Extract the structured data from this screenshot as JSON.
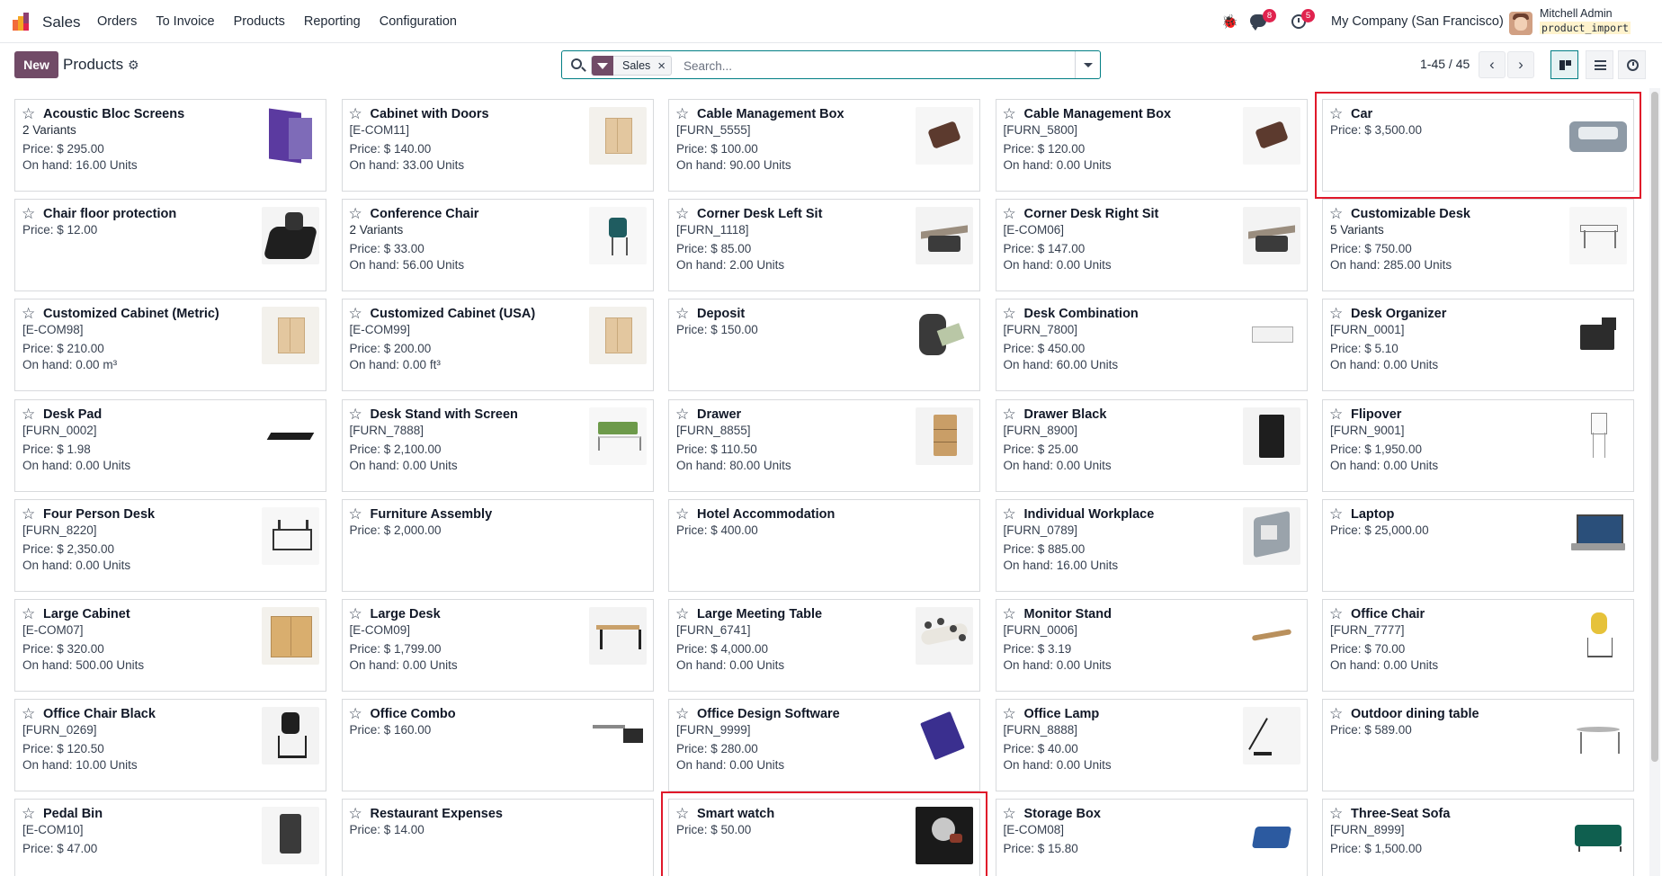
{
  "navbar": {
    "app_name": "Sales",
    "menu": [
      "Orders",
      "To Invoice",
      "Products",
      "Reporting",
      "Configuration"
    ],
    "messages_badge": "8",
    "activities_badge": "5",
    "company": "My Company (San Francisco)",
    "user_name": "Mitchell Admin",
    "database": "product_import"
  },
  "control_panel": {
    "new_label": "New",
    "title": "Products",
    "search": {
      "facet_label": "Sales",
      "placeholder": "Search..."
    },
    "pager": {
      "value": "1-45 / 45"
    }
  },
  "products": [
    {
      "name": "Acoustic Bloc Screens",
      "sub": "2 Variants",
      "price": "Price: $ 295.00",
      "onhand": "On hand: 16.00 Units",
      "thumb": "screens"
    },
    {
      "name": "Cabinet with Doors",
      "sub": "[E-COM11]",
      "price": "Price: $ 140.00",
      "onhand": "On hand: 33.00 Units",
      "thumb": "wood"
    },
    {
      "name": "Cable Management Box",
      "sub": "[FURN_5555]",
      "price": "Price: $ 100.00",
      "onhand": "On hand: 90.00 Units",
      "thumb": "dark-box"
    },
    {
      "name": "Cable Management Box",
      "sub": "[FURN_5800]",
      "price": "Price: $ 120.00",
      "onhand": "On hand: 0.00 Units",
      "thumb": "dark-box"
    },
    {
      "name": "Car",
      "sub": "",
      "price": "Price: $ 3,500.00",
      "onhand": "",
      "thumb": "car"
    },
    {
      "name": "Chair floor protection",
      "sub": "",
      "price": "Price: $ 12.00",
      "onhand": "",
      "thumb": "chairmat"
    },
    {
      "name": "Conference Chair",
      "sub": "2 Variants",
      "price": "Price: $ 33.00",
      "onhand": "On hand: 56.00 Units",
      "thumb": "teal-chair"
    },
    {
      "name": "Corner Desk Left Sit",
      "sub": "[FURN_1118]",
      "price": "Price: $ 85.00",
      "onhand": "On hand: 2.00 Units",
      "thumb": "desk-scene"
    },
    {
      "name": "Corner Desk Right Sit",
      "sub": "[E-COM06]",
      "price": "Price: $ 147.00",
      "onhand": "On hand: 0.00 Units",
      "thumb": "desk-scene"
    },
    {
      "name": "Customizable Desk",
      "sub": "5 Variants",
      "price": "Price: $ 750.00",
      "onhand": "On hand: 285.00 Units",
      "thumb": "white-desk"
    },
    {
      "name": "Customized Cabinet (Metric)",
      "sub": "[E-COM98]",
      "price": "Price: $ 210.00",
      "onhand": "On hand: 0.00 m³",
      "thumb": "wood"
    },
    {
      "name": "Customized Cabinet (USA)",
      "sub": "[E-COM99]",
      "price": "Price: $ 200.00",
      "onhand": "On hand: 0.00 ft³",
      "thumb": "wood"
    },
    {
      "name": "Deposit",
      "sub": "",
      "price": "Price: $ 150.00",
      "onhand": "",
      "thumb": "deposit"
    },
    {
      "name": "Desk Combination",
      "sub": "[FURN_7800]",
      "price": "Price: $ 450.00",
      "onhand": "On hand: 60.00 Units",
      "thumb": "glass-desk"
    },
    {
      "name": "Desk Organizer",
      "sub": "[FURN_0001]",
      "price": "Price: $ 5.10",
      "onhand": "On hand: 0.00 Units",
      "thumb": "organizer"
    },
    {
      "name": "Desk Pad",
      "sub": "[FURN_0002]",
      "price": "Price: $ 1.98",
      "onhand": "On hand: 0.00 Units",
      "thumb": "pad"
    },
    {
      "name": "Desk Stand with Screen",
      "sub": "[FURN_7888]",
      "price": "Price: $ 2,100.00",
      "onhand": "On hand: 0.00 Units",
      "thumb": "green-desk"
    },
    {
      "name": "Drawer",
      "sub": "[FURN_8855]",
      "price": "Price: $ 110.50",
      "onhand": "On hand: 80.00 Units",
      "thumb": "drawer"
    },
    {
      "name": "Drawer Black",
      "sub": "[FURN_8900]",
      "price": "Price: $ 25.00",
      "onhand": "On hand: 0.00 Units",
      "thumb": "black-drawer"
    },
    {
      "name": "Flipover",
      "sub": "[FURN_9001]",
      "price": "Price: $ 1,950.00",
      "onhand": "On hand: 0.00 Units",
      "thumb": "flip"
    },
    {
      "name": "Four Person Desk",
      "sub": "[FURN_8220]",
      "price": "Price: $ 2,350.00",
      "onhand": "On hand: 0.00 Units",
      "thumb": "person-desk"
    },
    {
      "name": "Furniture Assembly",
      "sub": "",
      "price": "Price: $ 2,000.00",
      "onhand": "",
      "thumb": ""
    },
    {
      "name": "Hotel Accommodation",
      "sub": "",
      "price": "Price: $ 400.00",
      "onhand": "",
      "thumb": ""
    },
    {
      "name": "Individual Workplace",
      "sub": "[FURN_0789]",
      "price": "Price: $ 885.00",
      "onhand": "On hand: 16.00 Units",
      "thumb": "workplace"
    },
    {
      "name": "Laptop",
      "sub": "",
      "price": "Price: $ 25,000.00",
      "onhand": "",
      "thumb": "laptop"
    },
    {
      "name": "Large Cabinet",
      "sub": "[E-COM07]",
      "price": "Price: $ 320.00",
      "onhand": "On hand: 500.00 Units",
      "thumb": "cabinet-l"
    },
    {
      "name": "Large Desk",
      "sub": "[E-COM09]",
      "price": "Price: $ 1,799.00",
      "onhand": "On hand: 0.00 Units",
      "thumb": "large-desk"
    },
    {
      "name": "Large Meeting Table",
      "sub": "[FURN_6741]",
      "price": "Price: $ 4,000.00",
      "onhand": "On hand: 0.00 Units",
      "thumb": "meeting"
    },
    {
      "name": "Monitor Stand",
      "sub": "[FURN_0006]",
      "price": "Price: $ 3.19",
      "onhand": "On hand: 0.00 Units",
      "thumb": "monitor"
    },
    {
      "name": "Office Chair",
      "sub": "[FURN_7777]",
      "price": "Price: $ 70.00",
      "onhand": "On hand: 0.00 Units",
      "thumb": "chair-yellow"
    },
    {
      "name": "Office Chair Black",
      "sub": "[FURN_0269]",
      "price": "Price: $ 120.50",
      "onhand": "On hand: 10.00 Units",
      "thumb": "chair-black"
    },
    {
      "name": "Office Combo",
      "sub": "",
      "price": "Price: $ 160.00",
      "onhand": "",
      "thumb": "combo"
    },
    {
      "name": "Office Design Software",
      "sub": "[FURN_9999]",
      "price": "Price: $ 280.00",
      "onhand": "On hand: 0.00 Units",
      "thumb": "software"
    },
    {
      "name": "Office Lamp",
      "sub": "[FURN_8888]",
      "price": "Price: $ 40.00",
      "onhand": "On hand: 0.00 Units",
      "thumb": "lamp"
    },
    {
      "name": "Outdoor dining table",
      "sub": "",
      "price": "Price: $ 589.00",
      "onhand": "",
      "thumb": "dining"
    },
    {
      "name": "Pedal Bin",
      "sub": "[E-COM10]",
      "price": "Price: $ 47.00",
      "onhand": "",
      "thumb": "bin"
    },
    {
      "name": "Restaurant Expenses",
      "sub": "",
      "price": "Price: $ 14.00",
      "onhand": "",
      "thumb": ""
    },
    {
      "name": "Smart watch",
      "sub": "",
      "price": "Price: $ 50.00",
      "onhand": "",
      "thumb": "watch"
    },
    {
      "name": "Storage Box",
      "sub": "[E-COM08]",
      "price": "Price: $ 15.80",
      "onhand": "",
      "thumb": "storage"
    },
    {
      "name": "Three-Seat Sofa",
      "sub": "[FURN_8999]",
      "price": "Price: $ 1,500.00",
      "onhand": "",
      "thumb": "sofa"
    }
  ],
  "highlighted": [
    "Car",
    "Smart watch"
  ]
}
